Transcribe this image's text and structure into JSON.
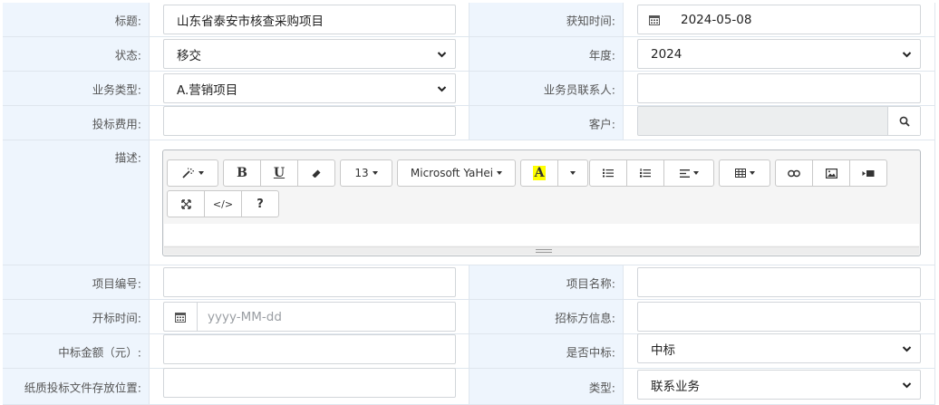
{
  "form": {
    "row1": {
      "title_label": "标题:",
      "title_value": "山东省泰安市核查采购项目",
      "known_time_label": "获知时间:",
      "known_time_value": "2024-05-08"
    },
    "row2": {
      "status_label": "状态:",
      "status_value": "移交",
      "year_label": "年度:",
      "year_value": "2024"
    },
    "row3": {
      "biz_type_label": "业务类型:",
      "biz_type_value": "A.营销项目",
      "contact_label": "业务员联系人:",
      "contact_value": ""
    },
    "row4": {
      "bid_fee_label": "投标费用:",
      "bid_fee_value": "",
      "customer_label": "客户:",
      "customer_value": ""
    },
    "desc": {
      "label": "描述:"
    },
    "row6": {
      "project_no_label": "项目编号:",
      "project_no_value": "",
      "project_name_label": "项目名称:",
      "project_name_value": ""
    },
    "row7": {
      "open_time_label": "开标时间:",
      "open_time_placeholder": "yyyy-MM-dd",
      "tenderer_label": "招标方信息:",
      "tenderer_value": ""
    },
    "row8": {
      "amount_label": "中标金额（元）:",
      "amount_value": "",
      "won_label": "是否中标:",
      "won_value": "中标"
    },
    "row9": {
      "paper_loc_label": "纸质投标文件存放位置:",
      "paper_loc_value": "",
      "type_label": "类型:",
      "type_value": "联系业务"
    }
  },
  "editor": {
    "font_size": "13",
    "font_name": "Microsoft YaHei",
    "bold": "B",
    "underline": "U",
    "highlight": "A",
    "help": "?",
    "code": "</>",
    "icons": [
      "magic-wand-icon",
      "eraser-icon",
      "unordered-list-icon",
      "ordered-list-icon",
      "align-icon",
      "table-icon",
      "link-icon",
      "image-icon",
      "video-icon",
      "fullscreen-icon",
      "code-view-icon",
      "help-icon"
    ]
  },
  "colors": {
    "label_bg": "#eef5fd",
    "border": "#dfe6ee",
    "highlight_yellow": "#ffff00"
  }
}
